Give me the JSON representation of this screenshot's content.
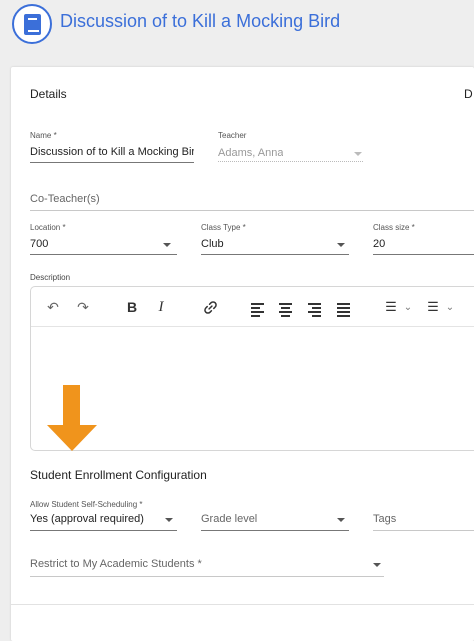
{
  "header": {
    "title": "Discussion of to Kill a Mocking Bird",
    "icon": "book-icon"
  },
  "details": {
    "title": "Details",
    "edge_label": "D"
  },
  "fields": {
    "name": {
      "label": "Name *",
      "value": "Discussion of to Kill a Mocking Bird"
    },
    "teacher": {
      "label": "Teacher",
      "value": "Adams, Anna"
    },
    "co_teacher": {
      "placeholder": "Co-Teacher(s)"
    },
    "location": {
      "label": "Location *",
      "value": "700"
    },
    "class_type": {
      "label": "Class Type *",
      "value": "Club"
    },
    "class_size": {
      "label": "Class size *",
      "value": "20"
    },
    "description": {
      "label": "Description"
    }
  },
  "toolbar": {
    "undo": "↶",
    "redo": "↷",
    "bold": "B",
    "italic": "I",
    "link": "🔗",
    "bullet_list": "☰",
    "numbered_list": "☰",
    "chevron": "⌄"
  },
  "enrollment": {
    "title": "Student Enrollment Configuration",
    "self_scheduling": {
      "label": "Allow Student Self-Scheduling *",
      "value": "Yes (approval required)"
    },
    "grade_level": {
      "placeholder": "Grade level"
    },
    "tags": {
      "placeholder": "Tags"
    },
    "restrict": {
      "placeholder": "Restrict to My Academic Students *"
    }
  },
  "colors": {
    "accent": "#3b6fd9",
    "arrow": "#f0941c"
  }
}
